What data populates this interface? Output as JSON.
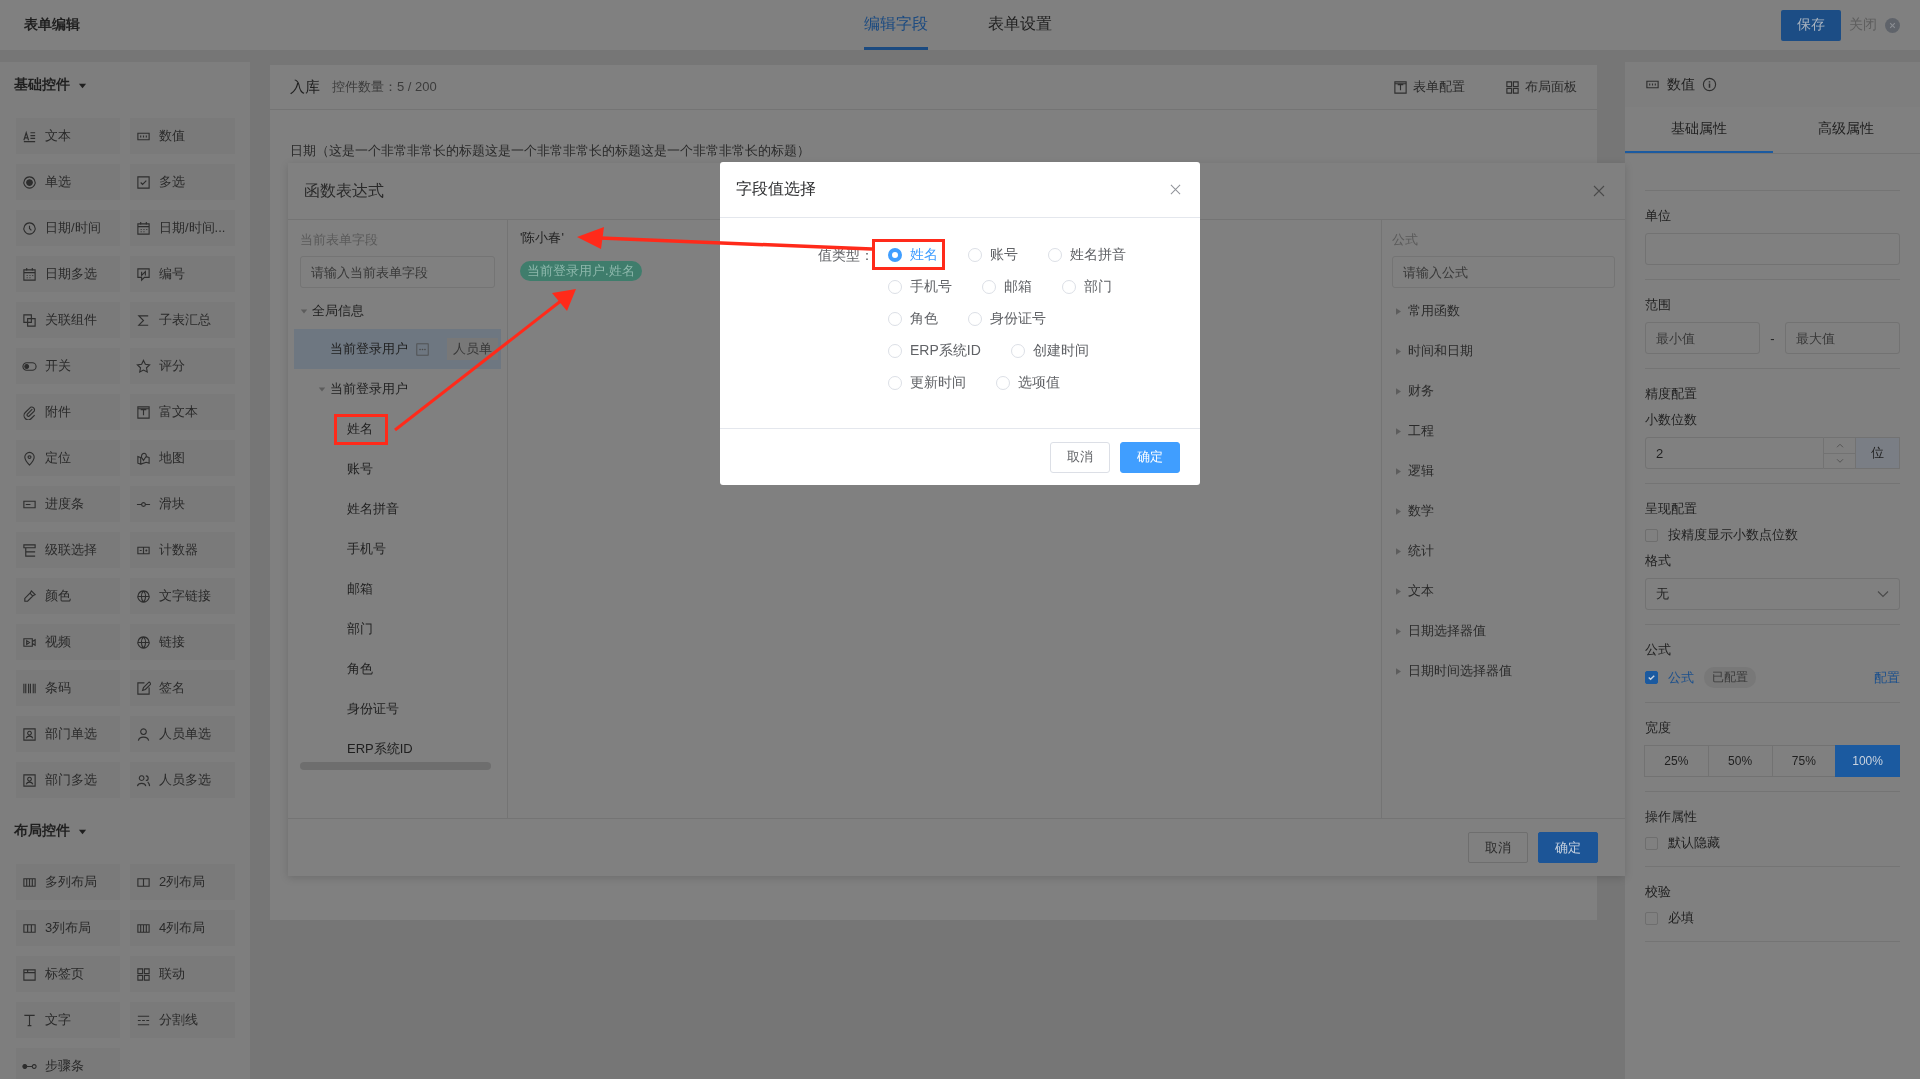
{
  "topbar": {
    "title": "表单编辑",
    "tabs": [
      {
        "label": "编辑字段",
        "selected": true
      },
      {
        "label": "表单设置",
        "selected": false
      }
    ],
    "save": "保存",
    "close": "关闭"
  },
  "sidebar": {
    "groups": [
      {
        "title": "基础控件",
        "expanded": true,
        "items": [
          "文本",
          "数值",
          "单选",
          "多选",
          "日期/时间",
          "日期/时间...",
          "日期多选",
          "编号",
          "关联组件",
          "子表汇总",
          "开关",
          "评分",
          "附件",
          "富文本",
          "定位",
          "地图",
          "进度条",
          "滑块",
          "级联选择",
          "计数器",
          "颜色",
          "文字链接",
          "视频",
          "链接",
          "条码",
          "签名",
          "部门单选",
          "人员单选",
          "部门多选",
          "人员多选"
        ]
      },
      {
        "title": "布局控件",
        "expanded": true,
        "items": [
          "多列布局",
          "2列布局",
          "3列布局",
          "4列布局",
          "标签页",
          "联动",
          "文字",
          "分割线",
          "步骤条"
        ]
      }
    ]
  },
  "form": {
    "title": "入库",
    "count": "控件数量：5 / 200",
    "actions": [
      "表单配置",
      "布局面板"
    ],
    "field_label": "日期（这是一个非常非常长的标题这是一个非常非常长的标题这是一个非常非常长的标题）"
  },
  "function_dialog": {
    "title": "函数表达式",
    "fields_label": "当前表单字段",
    "fields_placeholder": "请输入当前表单字段",
    "tree": [
      {
        "label": "全局信息",
        "expanded": true,
        "children": [
          {
            "label": "当前登录用户",
            "selected": true,
            "tag": "人员单"
          },
          {
            "label": "当前登录用户",
            "selected": false,
            "expanded": true,
            "children": [
              {
                "label": "姓名"
              },
              {
                "label": "账号"
              },
              {
                "label": "姓名拼音"
              },
              {
                "label": "手机号"
              },
              {
                "label": "邮箱"
              },
              {
                "label": "部门"
              },
              {
                "label": "角色"
              },
              {
                "label": "身份证号"
              },
              {
                "label": "ERP系统ID"
              }
            ]
          }
        ]
      }
    ],
    "expression": "'陈小春'",
    "token": "当前登录用户.姓名",
    "formula_label": "公式",
    "formula_placeholder": "请输入公式",
    "categories": [
      "常用函数",
      "时间和日期",
      "财务",
      "工程",
      "逻辑",
      "数学",
      "统计",
      "文本",
      "日期选择器值",
      "日期时间选择器值"
    ],
    "cancel": "取消",
    "confirm": "确定"
  },
  "value_dialog": {
    "title": "字段值选择",
    "label": "值类型：",
    "options": [
      {
        "label": "姓名",
        "selected": true
      },
      {
        "label": "账号",
        "selected": false
      },
      {
        "label": "姓名拼音",
        "selected": false
      },
      {
        "label": "手机号",
        "selected": false
      },
      {
        "label": "邮箱",
        "selected": false
      },
      {
        "label": "部门",
        "selected": false
      },
      {
        "label": "角色",
        "selected": false
      },
      {
        "label": "身份证号",
        "selected": false
      },
      {
        "label": "ERP系统ID",
        "selected": false
      },
      {
        "label": "创建时间",
        "selected": false
      },
      {
        "label": "更新时间",
        "selected": false
      },
      {
        "label": "选项值",
        "selected": false
      }
    ],
    "cancel": "取消",
    "confirm": "确定"
  },
  "properties": {
    "title": "数值",
    "tabs": [
      {
        "label": "基础属性",
        "selected": true
      },
      {
        "label": "高级属性",
        "selected": false
      }
    ],
    "unit": {
      "label": "单位"
    },
    "range": {
      "label": "范围",
      "min_placeholder": "最小值",
      "separator": "-",
      "max_placeholder": "最大值"
    },
    "precision": {
      "label": "精度配置",
      "sublabel": "小数位数",
      "value": "2",
      "suffix": "位"
    },
    "display": {
      "label": "呈现配置",
      "checkbox": {
        "label": "按精度显示小数点位数",
        "checked": false
      },
      "format_label": "格式",
      "format_value": "无"
    },
    "formula": {
      "label": "公式",
      "checkbox": {
        "label": "公式",
        "checked": true
      },
      "badge": "已配置",
      "link": "配置"
    },
    "width": {
      "label": "宽度",
      "options": [
        {
          "label": "25%",
          "selected": false
        },
        {
          "label": "50%",
          "selected": false
        },
        {
          "label": "75%",
          "selected": false
        },
        {
          "label": "100%",
          "selected": true
        }
      ]
    },
    "operation": {
      "label": "操作属性",
      "checkbox": {
        "label": "默认隐藏",
        "checked": false
      }
    },
    "validation": {
      "label": "校验",
      "checkbox": {
        "label": "必填",
        "checked": false
      }
    }
  }
}
